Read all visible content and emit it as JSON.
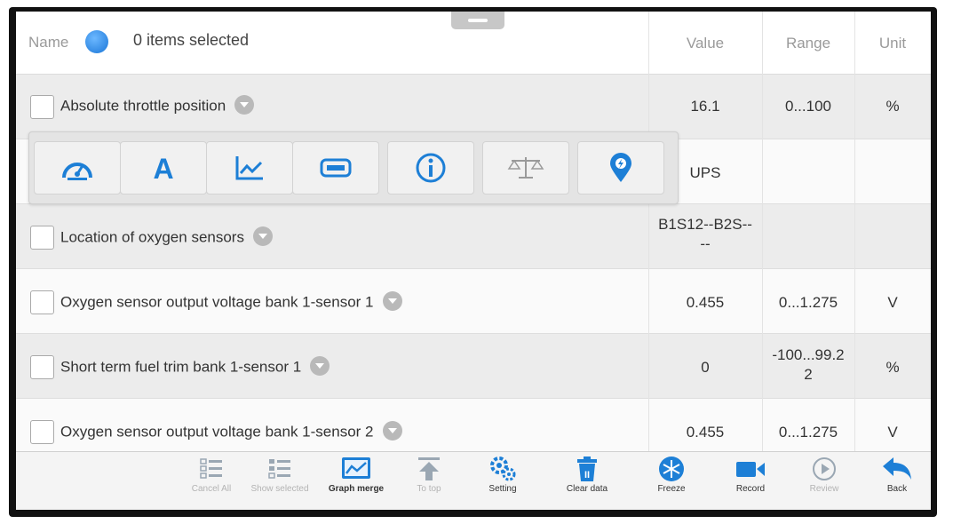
{
  "header": {
    "name_label": "Name",
    "selected_text": "0 items selected",
    "columns": {
      "value": "Value",
      "range": "Range",
      "unit": "Unit"
    }
  },
  "rows": [
    {
      "name": "Absolute throttle position",
      "value": "16.1",
      "range": "0...100",
      "unit": "%"
    },
    {
      "name": "",
      "value": "UPS",
      "range": "",
      "unit": ""
    },
    {
      "name": "Location of oxygen sensors",
      "value": "B1S12--B2S--\n--",
      "range": "",
      "unit": ""
    },
    {
      "name": "Oxygen sensor output voltage bank 1-sensor 1",
      "value": "0.455",
      "range": "0...1.275",
      "unit": "V"
    },
    {
      "name": "Short term fuel trim bank 1-sensor 1",
      "value": "0",
      "range": "-100...99.2\n2",
      "unit": "%"
    },
    {
      "name": "Oxygen sensor output voltage bank 1-sensor 2",
      "value": "0.455",
      "range": "0...1.275",
      "unit": "V"
    }
  ],
  "popup_icons": [
    "gauge-icon",
    "text-icon",
    "line-chart-icon",
    "bar-display-icon",
    "info-icon",
    "balance-scale-icon",
    "location-pin-icon"
  ],
  "bottom_bar": [
    {
      "label": "Cancel All",
      "icon": "list-icon",
      "enabled": false
    },
    {
      "label": "Show selected",
      "icon": "list-icon",
      "enabled": false
    },
    {
      "label": "Graph merge",
      "icon": "graph-merge-icon",
      "enabled": true
    },
    {
      "label": "To top",
      "icon": "to-top-icon",
      "enabled": false
    },
    {
      "label": "Setting",
      "icon": "setting-icon",
      "enabled": true
    },
    {
      "label": "Clear data",
      "icon": "trash-icon",
      "enabled": true
    },
    {
      "label": "Freeze",
      "icon": "snowflake-icon",
      "enabled": true
    },
    {
      "label": "Record",
      "icon": "video-camera-icon",
      "enabled": true
    },
    {
      "label": "Review",
      "icon": "play-icon",
      "enabled": false
    },
    {
      "label": "Back",
      "icon": "back-arrow-icon",
      "enabled": true
    }
  ],
  "colors": {
    "accent_blue": "#1a76d8",
    "disabled": "#b3b3b3"
  }
}
